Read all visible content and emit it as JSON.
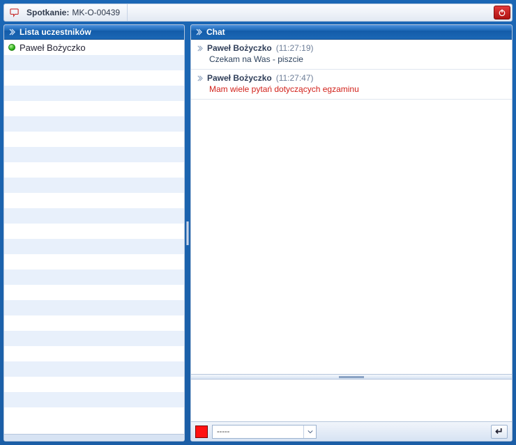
{
  "header": {
    "label": "Spotkanie:",
    "meeting_id": "MK-O-00439"
  },
  "left_panel": {
    "title": "Lista uczestników"
  },
  "participants": [
    {
      "name": "Paweł Bożyczko",
      "presence": "online"
    }
  ],
  "right_panel": {
    "title": "Chat"
  },
  "messages": [
    {
      "author": "Paweł Bożyczko",
      "time": "11:27:19",
      "text": "Czekam na Was - piszcie",
      "color": "default"
    },
    {
      "author": "Paweł Bożyczko",
      "time": "11:27:47",
      "text": "Mam wiele pytań dotyczących egzaminu",
      "color": "red"
    }
  ],
  "toolbar": {
    "color_value": "#ff1212",
    "font_select_value": "-----",
    "send_glyph": "↵"
  },
  "striped_row_count": 24
}
